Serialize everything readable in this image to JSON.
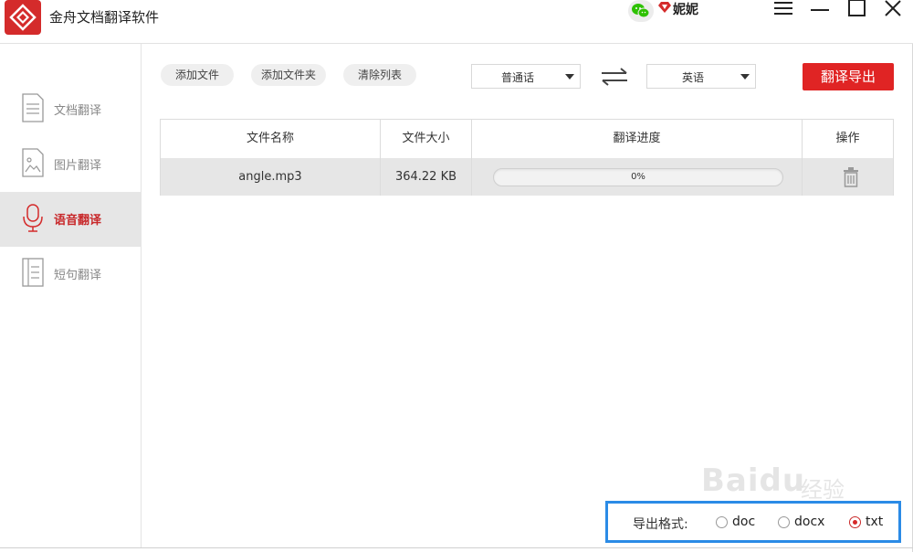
{
  "app": {
    "title": "金舟文档翻译软件"
  },
  "user": {
    "name": "妮妮"
  },
  "sidebar": {
    "items": [
      {
        "label": "文档翻译",
        "active": false,
        "icon": "document-icon"
      },
      {
        "label": "图片翻译",
        "active": false,
        "icon": "image-icon"
      },
      {
        "label": "语音翻译",
        "active": true,
        "icon": "microphone-icon"
      },
      {
        "label": "短句翻译",
        "active": false,
        "icon": "text-lines-icon"
      }
    ]
  },
  "toolbar": {
    "add_file": "添加文件",
    "add_folder": "添加文件夹",
    "clear_list": "清除列表",
    "source_language": "普通话",
    "target_language": "英语",
    "export_button": "翻译导出"
  },
  "table": {
    "headers": {
      "name": "文件名称",
      "size": "文件大小",
      "progress": "翻译进度",
      "action": "操作"
    },
    "rows": [
      {
        "name": "angle.mp3",
        "size": "364.22 KB",
        "progress_text": "0%",
        "progress_value": 0
      }
    ]
  },
  "export_format": {
    "label": "导出格式:",
    "options": [
      {
        "label": "doc",
        "selected": false
      },
      {
        "label": "docx",
        "selected": false
      },
      {
        "label": "txt",
        "selected": true
      }
    ]
  },
  "watermark": {
    "brand": "Bai",
    "paw": "du",
    "text": "经验"
  },
  "colors": {
    "accent": "#e02424",
    "highlight_box": "#2b8be6",
    "active_bg": "#e6e6e6"
  }
}
